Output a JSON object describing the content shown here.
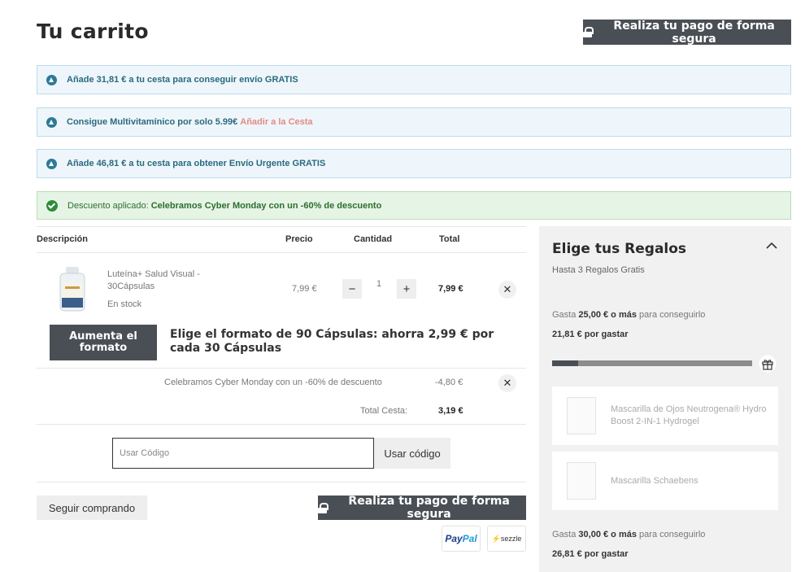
{
  "header": {
    "title": "Tu carrito",
    "secure_checkout": "Realiza tu pago de forma segura"
  },
  "notices": [
    {
      "text": "Añade 31,81 € a tu cesta para conseguir envío GRATIS",
      "link": ""
    },
    {
      "text": "Consigue Multivitamínico por solo 5.99€",
      "link": "Añadir a la Cesta"
    },
    {
      "text": "Añade 46,81 € a tu cesta para obtener Envío Urgente GRATIS",
      "link": ""
    }
  ],
  "discount_notice": {
    "prefix": "Descuento aplicado:",
    "text": "Celebramos Cyber Monday con un -60% de descuento"
  },
  "table": {
    "headers": [
      "Descripción",
      "Precio",
      "Cantidad",
      "Total"
    ]
  },
  "product": {
    "name": "Luteína+ Salud Visual - 30Cápsulas",
    "stock": "En stock",
    "price": "7,99 €",
    "quantity": "1",
    "total": "7,99 €",
    "minus": "−",
    "plus": "+",
    "remove": "✕"
  },
  "upgrade": {
    "button": "Aumenta el formato",
    "text_prefix": "Elige el formato de",
    "text_bold": "90 Cápsulas: ahorra 2,99 € por cada 30 Cápsulas"
  },
  "discount_row": {
    "label": "Celebramos Cyber Monday con un -60% de descuento",
    "value": "-4,80 €",
    "remove": "✕"
  },
  "total": {
    "label": "Total Cesta:",
    "value": "3,19 €"
  },
  "coupon": {
    "placeholder": "Usar Código",
    "button": "Usar código"
  },
  "footer": {
    "continue": "Seguir comprando",
    "secure_checkout": "Realiza tu pago de forma segura",
    "paypal_pay": "Pay",
    "paypal_pal": "Pal",
    "sezzle": "sezzle"
  },
  "gifts": {
    "title": "Elige tus Regalos",
    "subtitle": "Hasta 3 Regalos Gratis",
    "tier1": {
      "spend_prefix": "Gasta",
      "spend_amount": "25,00 € o más",
      "spend_suffix": "para conseguirlo",
      "remaining": "21,81 € por gastar",
      "progress": 0.13
    },
    "items": [
      "Mascarilla de Ojos Neutrogena® Hydro Boost 2-IN-1 Hydrogel",
      "Mascarilla Schaebens"
    ],
    "tier2": {
      "spend_prefix": "Gasta",
      "spend_amount": "30,00 € o más",
      "spend_suffix": "para conseguirlo",
      "remaining": "26,81 € por gastar"
    }
  },
  "colors": {
    "dark_button": "#4a4f55",
    "notice_bg": "#eef6fb",
    "notice_text": "#2b6a80",
    "success_bg": "#e6f4e6",
    "success_text": "#2c6e2c",
    "link_accent": "#e58a86"
  }
}
